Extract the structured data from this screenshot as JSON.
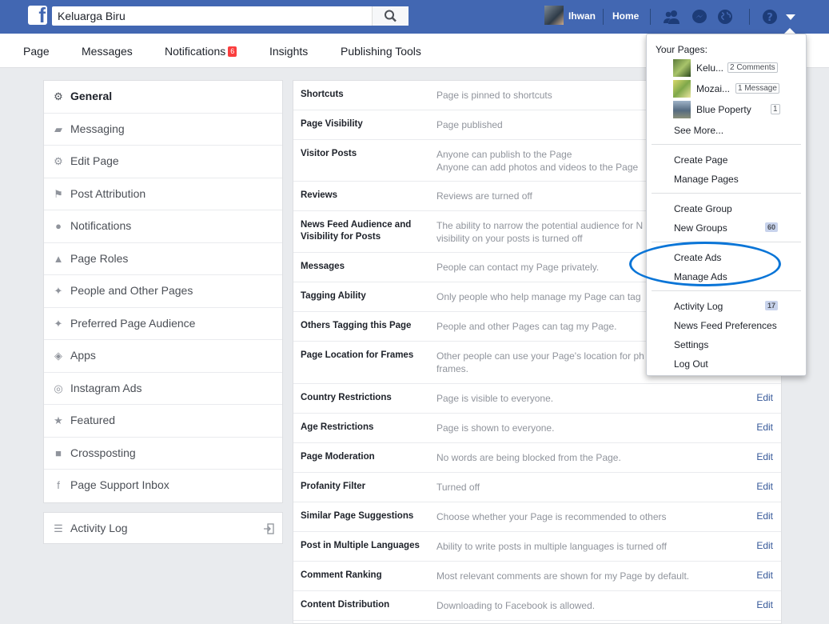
{
  "search": {
    "value": "Keluarga Biru"
  },
  "topbar": {
    "user_name": "Ihwan",
    "home": "Home"
  },
  "page_nav": {
    "page": "Page",
    "messages": "Messages",
    "notifications": "Notifications",
    "notifications_count": "6",
    "insights": "Insights",
    "publishing_tools": "Publishing Tools"
  },
  "left_menu": [
    {
      "label": "General",
      "icon": "gear-icon"
    },
    {
      "label": "Messaging",
      "icon": "chat-icon"
    },
    {
      "label": "Edit Page",
      "icon": "gear-icon"
    },
    {
      "label": "Post Attribution",
      "icon": "flag-icon"
    },
    {
      "label": "Notifications",
      "icon": "globe-icon"
    },
    {
      "label": "Page Roles",
      "icon": "person-icon"
    },
    {
      "label": "People and Other Pages",
      "icon": "person-star-icon"
    },
    {
      "label": "Preferred Page Audience",
      "icon": "person-star-icon"
    },
    {
      "label": "Apps",
      "icon": "cube-icon"
    },
    {
      "label": "Instagram Ads",
      "icon": "instagram-icon"
    },
    {
      "label": "Featured",
      "icon": "star-icon"
    },
    {
      "label": "Crossposting",
      "icon": "video-icon"
    },
    {
      "label": "Page Support Inbox",
      "icon": "facebook-icon"
    }
  ],
  "activity_log": {
    "label": "Activity Log"
  },
  "settings": [
    {
      "label": "Shortcuts",
      "value": "Page is pinned to shortcuts",
      "edit": ""
    },
    {
      "label": "Page Visibility",
      "value": "Page published",
      "edit": ""
    },
    {
      "label": "Visitor Posts",
      "value": "Anyone can publish to the Page\nAnyone can add photos and videos to the Page",
      "edit": ""
    },
    {
      "label": "Reviews",
      "value": "Reviews are turned off",
      "edit": ""
    },
    {
      "label": "News Feed Audience and Visibility for Posts",
      "value": "The ability to narrow the potential audience for N\nvisibility on your posts is turned off",
      "edit": ""
    },
    {
      "label": "Messages",
      "value": "People can contact my Page privately.",
      "edit": ""
    },
    {
      "label": "Tagging Ability",
      "value": "Only people who help manage my Page can tag",
      "edit": ""
    },
    {
      "label": "Others Tagging this Page",
      "value": "People and other Pages can tag my Page.",
      "edit": ""
    },
    {
      "label": "Page Location for Frames",
      "value": "Other people can use your Page's location for ph\nframes.",
      "edit": ""
    },
    {
      "label": "Country Restrictions",
      "value": "Page is visible to everyone.",
      "edit": "Edit"
    },
    {
      "label": "Age Restrictions",
      "value": "Page is shown to everyone.",
      "edit": "Edit"
    },
    {
      "label": "Page Moderation",
      "value": "No words are being blocked from the Page.",
      "edit": "Edit"
    },
    {
      "label": "Profanity Filter",
      "value": "Turned off",
      "edit": "Edit"
    },
    {
      "label": "Similar Page Suggestions",
      "value": "Choose whether your Page is recommended to others",
      "edit": "Edit"
    },
    {
      "label": "Post in Multiple Languages",
      "value": "Ability to write posts in multiple languages is turned off",
      "edit": "Edit"
    },
    {
      "label": "Comment Ranking",
      "value": "Most relevant comments are shown for my Page by default.",
      "edit": "Edit"
    },
    {
      "label": "Content Distribution",
      "value": "Downloading to Facebook is allowed.",
      "edit": "Edit"
    }
  ],
  "dropdown": {
    "heading": "Your Pages:",
    "pages": [
      {
        "name": "Kelu...",
        "count": "2 Comments"
      },
      {
        "name": "Mozai...",
        "count": "1 Message"
      },
      {
        "name": "Blue Poperty",
        "count": "1"
      }
    ],
    "see_more": "See More...",
    "create_page": "Create Page",
    "manage_pages": "Manage Pages",
    "create_group": "Create Group",
    "new_groups": "New Groups",
    "new_groups_count": "60",
    "create_ads": "Create Ads",
    "manage_ads": "Manage Ads",
    "activity_log": "Activity Log",
    "activity_log_count": "17",
    "news_feed_preferences": "News Feed Preferences",
    "settings": "Settings",
    "log_out": "Log Out"
  },
  "colors": {
    "brand": "#4267b2",
    "highlight": "#0a75d7",
    "link": "#365899"
  }
}
